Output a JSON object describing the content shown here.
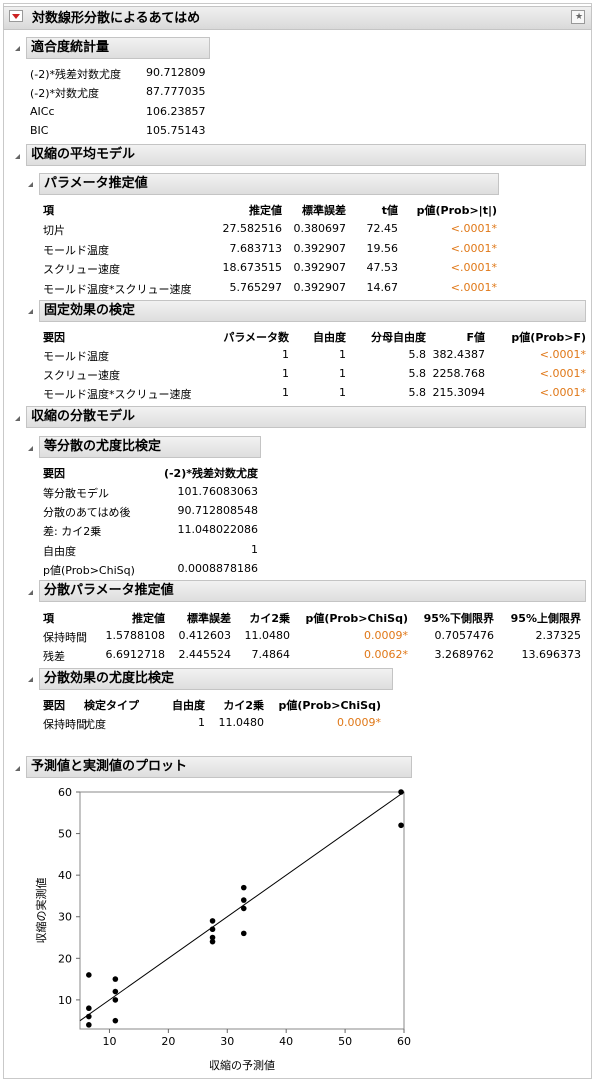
{
  "main_title": "対数線形分散によるあてはめ",
  "fit": {
    "title": "適合度統計量",
    "rows": [
      {
        "label": "(-2)*残差対数尤度",
        "value": "90.712809"
      },
      {
        "label": "(-2)*対数尤度",
        "value": "87.777035"
      },
      {
        "label": "AICc",
        "value": "106.23857"
      },
      {
        "label": "BIC",
        "value": "105.75143"
      }
    ]
  },
  "mean_model": {
    "title": "収縮の平均モデル",
    "params": {
      "title": "パラメータ推定値",
      "headers": [
        "項",
        "推定値",
        "標準誤差",
        "t値",
        "p値(Prob>|t|)"
      ],
      "rows": [
        [
          "切片",
          "27.582516",
          "0.380697",
          "72.45",
          "<.0001*"
        ],
        [
          "モールド温度",
          "7.683713",
          "0.392907",
          "19.56",
          "<.0001*"
        ],
        [
          "スクリュー速度",
          "18.673515",
          "0.392907",
          "47.53",
          "<.0001*"
        ],
        [
          "モールド温度*スクリュー速度",
          "5.765297",
          "0.392907",
          "14.67",
          "<.0001*"
        ]
      ]
    },
    "fixed": {
      "title": "固定効果の検定",
      "headers": [
        "要因",
        "パラメータ数",
        "自由度",
        "分母自由度",
        "F値",
        "p値(Prob>F)"
      ],
      "rows": [
        [
          "モールド温度",
          "1",
          "1",
          "5.8",
          "382.4387",
          "<.0001*"
        ],
        [
          "スクリュー速度",
          "1",
          "1",
          "5.8",
          "2258.768",
          "<.0001*"
        ],
        [
          "モールド温度*スクリュー速度",
          "1",
          "1",
          "5.8",
          "215.3094",
          "<.0001*"
        ]
      ]
    }
  },
  "var_model": {
    "title": "収縮の分散モデル",
    "lr": {
      "title": "等分散の尤度比検定",
      "headers": [
        "要因",
        "(-2)*残差対数尤度"
      ],
      "rows": [
        [
          "等分散モデル",
          "101.76083063"
        ],
        [
          "分散のあてはめ後",
          "90.712808548"
        ],
        [
          "差: カイ2乗",
          "11.048022086"
        ],
        [
          "自由度",
          "1"
        ],
        [
          "p値(Prob>ChiSq)",
          "0.0008878186"
        ]
      ]
    },
    "vparams": {
      "title": "分散パラメータ推定値",
      "headers": [
        "項",
        "推定値",
        "標準誤差",
        "カイ2乗",
        "p値(Prob>ChiSq)",
        "95%下側限界",
        "95%上側限界"
      ],
      "rows": [
        [
          "保持時間",
          "1.5788108",
          "0.412603",
          "11.0480",
          "0.0009*",
          "0.7057476",
          "2.37325"
        ],
        [
          "残差",
          "6.6912718",
          "2.445524",
          "7.4864",
          "0.0062*",
          "3.2689762",
          "13.696373"
        ]
      ]
    },
    "veff": {
      "title": "分散効果の尤度比検定",
      "headers": [
        "要因",
        "検定タイプ",
        "自由度",
        "カイ2乗",
        "p値(Prob>ChiSq)"
      ],
      "rows": [
        [
          "保持時間",
          "尤度",
          "1",
          "11.0480",
          "0.0009*"
        ]
      ]
    }
  },
  "plot": {
    "title": "予測値と実測値のプロット",
    "chart_data": {
      "type": "scatter",
      "xlabel": "収縮の予測値",
      "ylabel": "収縮の実測値",
      "xlim": [
        5,
        60
      ],
      "ylim": [
        3,
        60
      ],
      "xticks": [
        10,
        20,
        30,
        40,
        50,
        60
      ],
      "yticks": [
        10,
        20,
        30,
        40,
        50,
        60
      ],
      "reference_line": "y = x",
      "points": [
        [
          6.5,
          16
        ],
        [
          6.5,
          8
        ],
        [
          6.5,
          6
        ],
        [
          6.5,
          4
        ],
        [
          11,
          15
        ],
        [
          11,
          12
        ],
        [
          11,
          10
        ],
        [
          11,
          5
        ],
        [
          27.5,
          29
        ],
        [
          27.5,
          27
        ],
        [
          27.5,
          25
        ],
        [
          27.5,
          24
        ],
        [
          32.8,
          37
        ],
        [
          32.8,
          34
        ],
        [
          32.8,
          32
        ],
        [
          32.8,
          26
        ],
        [
          59.5,
          60
        ],
        [
          59.5,
          52
        ]
      ],
      "point_color": "#000000"
    }
  }
}
